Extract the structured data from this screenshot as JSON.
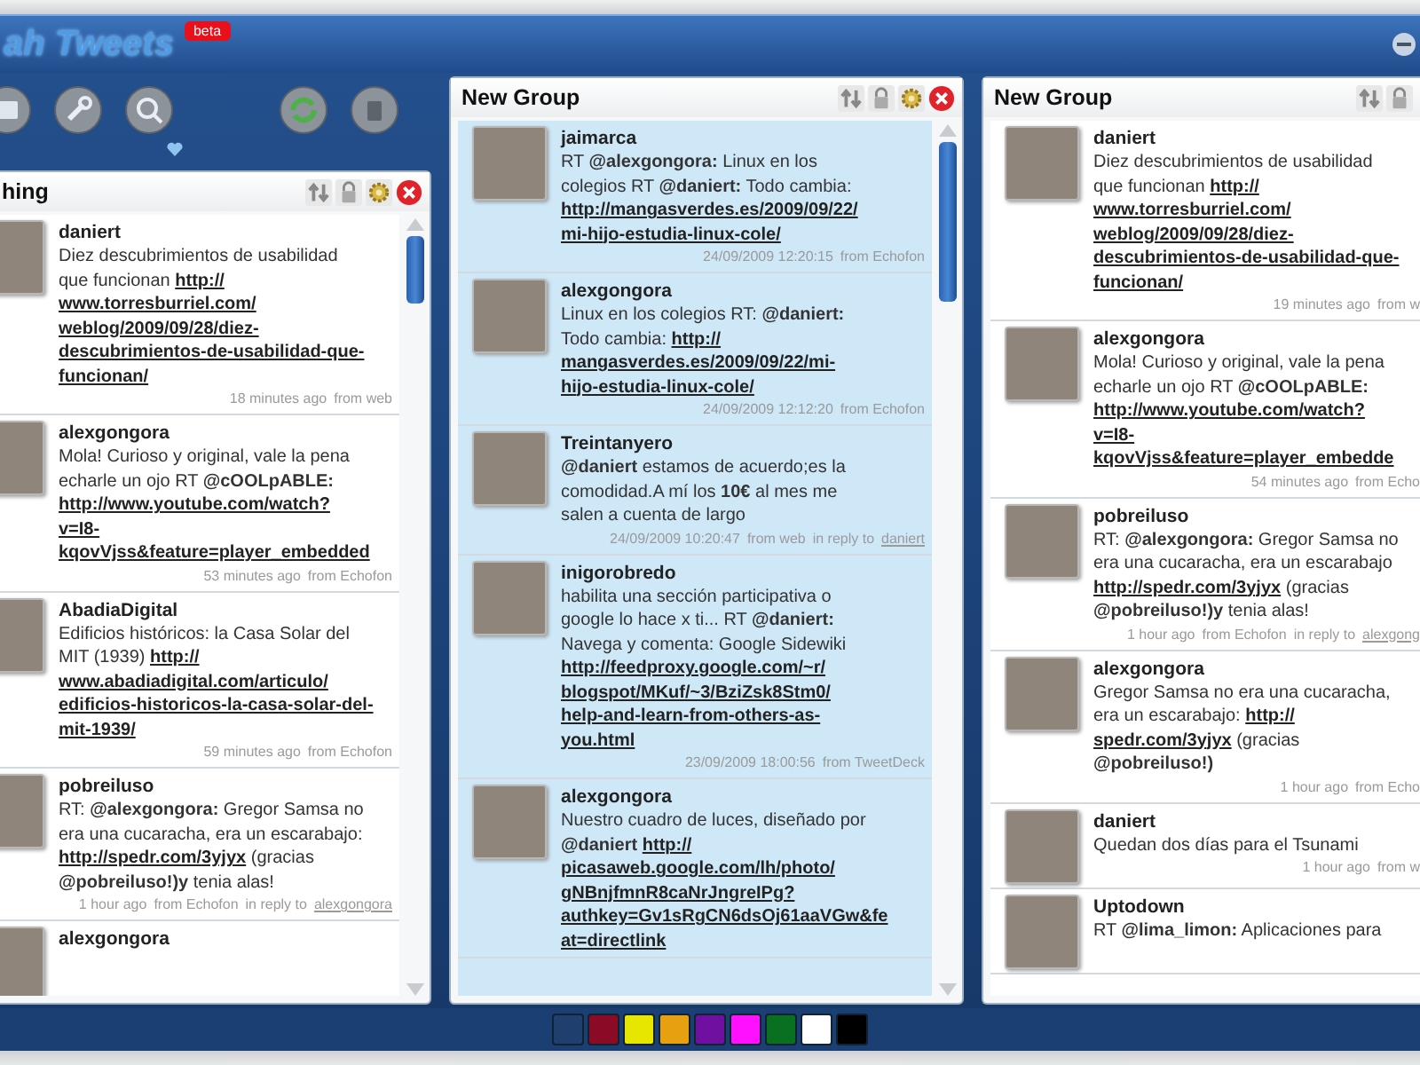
{
  "window": {
    "logo": "ah Tweets",
    "badge": "beta"
  },
  "columns": [
    {
      "title": "hing",
      "color": "#ffffff",
      "tweets": [
        {
          "user": "daniert",
          "lines": [
            {
              "text": "Diez descubrimientos de usabilidad"
            },
            {
              "text": "que funcionan ",
              "link": "http://"
            },
            {
              "link": "www.torresburriel.com/"
            },
            {
              "link": "weblog/2009/09/28/diez-"
            },
            {
              "link": "descubrimientos-de-usabilidad-que-"
            },
            {
              "link": "funcionan/"
            }
          ],
          "meta": {
            "time": "18 minutes ago",
            "source": "from web"
          }
        },
        {
          "user": "alexgongora",
          "lines": [
            {
              "text": "Mola! Curioso y original, vale la pena"
            },
            {
              "text": "echarle un ojo RT **@cOOLpABLE:**"
            },
            {
              "link": "http://www.youtube.com/watch?"
            },
            {
              "link": "v=I8-"
            },
            {
              "link": "kqovVjss&feature=player_embedded"
            }
          ],
          "meta": {
            "time": "53 minutes ago",
            "source": "from Echofon"
          }
        },
        {
          "user": "AbadiaDigital",
          "lines": [
            {
              "text": "Edificios históricos: la Casa Solar del"
            },
            {
              "text": "MIT (1939) ",
              "link": "http://"
            },
            {
              "link": "www.abadiadigital.com/articulo/"
            },
            {
              "link": "edificios-historicos-la-casa-solar-del-"
            },
            {
              "link": "mit-1939/"
            }
          ],
          "meta": {
            "time": "59 minutes ago",
            "source": "from Echofon"
          }
        },
        {
          "user": "pobreiluso",
          "lines": [
            {
              "text": "RT: **@alexgongora:** Gregor Samsa no"
            },
            {
              "text": "era una cucaracha, era un escarabajo:"
            },
            {
              "link": "http://spedr.com/3yjyx",
              "after": " (gracias"
            },
            {
              "text": "**@pobreiluso!)y** tenia alas!"
            }
          ],
          "meta": {
            "time": "1 hour ago",
            "source": "from Echofon",
            "reply_label": "in reply to",
            "reply_to": "alexgongora"
          }
        },
        {
          "user": "alexgongora"
        }
      ]
    },
    {
      "title": "New Group",
      "color": "#cfe8f8",
      "tweets": [
        {
          "user": "jaimarca",
          "lines": [
            {
              "text": "RT **@alexgongora:** Linux en los"
            },
            {
              "text": "colegios RT **@daniert:** Todo cambia:"
            },
            {
              "link": "http://mangasverdes.es/2009/09/22/"
            },
            {
              "link": "mi-hijo-estudia-linux-cole/"
            }
          ],
          "meta": {
            "time": "24/09/2009 12:20:15",
            "source": "from Echofon"
          }
        },
        {
          "user": "alexgongora",
          "lines": [
            {
              "text": "Linux en los colegios RT: **@daniert:**"
            },
            {
              "text": "Todo cambia: ",
              "link": "http://"
            },
            {
              "link": "mangasverdes.es/2009/09/22/mi-"
            },
            {
              "link": "hijo-estudia-linux-cole/"
            }
          ],
          "meta": {
            "time": "24/09/2009 12:12:20",
            "source": "from Echofon"
          }
        },
        {
          "user": "Treintanyero",
          "lines": [
            {
              "text": "**@daniert** estamos de acuerdo;es la"
            },
            {
              "text": "comodidad.A mí los **10€** al mes me"
            },
            {
              "text": "salen a cuenta de largo"
            }
          ],
          "meta": {
            "time": "24/09/2009 10:20:47",
            "source": "from web",
            "reply_label": "in reply to",
            "reply_to": "daniert"
          }
        },
        {
          "user": "inigorobredo",
          "lines": [
            {
              "text": "habilita una sección participativa o"
            },
            {
              "text": "google lo hace x ti... RT **@daniert:**"
            },
            {
              "text": "Navega y comenta: Google Sidewiki"
            },
            {
              "link": "http://feedproxy.google.com/~r/"
            },
            {
              "link": "blogspot/MKuf/~3/BziZsk8Stm0/"
            },
            {
              "link": "help-and-learn-from-others-as-"
            },
            {
              "link": "you.html"
            }
          ],
          "meta": {
            "time": "23/09/2009 18:00:56",
            "source": "from TweetDeck"
          }
        },
        {
          "user": "alexgongora",
          "lines": [
            {
              "text": "Nuestro cuadro de luces, diseñado por"
            },
            {
              "text": "**@daniert** ",
              "link": "http://"
            },
            {
              "link": "picasaweb.google.com/lh/photo/"
            },
            {
              "link": "gNBnjfmnR8caNrJngreIPg?"
            },
            {
              "link": "authkey=Gv1sRgCN6dsOj61aaVGw&fe"
            },
            {
              "link": "at=directlink"
            }
          ]
        }
      ]
    },
    {
      "title": "New Group",
      "color": "#ffffff",
      "tweets": [
        {
          "user": "daniert",
          "lines": [
            {
              "text": "Diez descubrimientos de usabilidad"
            },
            {
              "text": "que funcionan ",
              "link": "http://"
            },
            {
              "link": "www.torresburriel.com/"
            },
            {
              "link": "weblog/2009/09/28/diez-"
            },
            {
              "link": "descubrimientos-de-usabilidad-que-"
            },
            {
              "link": "funcionan/"
            }
          ],
          "meta": {
            "time": "19 minutes ago",
            "source": "from w"
          }
        },
        {
          "user": "alexgongora",
          "lines": [
            {
              "text": "Mola! Curioso y original, vale la pena"
            },
            {
              "text": "echarle un ojo RT **@cOOLpABLE:**"
            },
            {
              "link": "http://www.youtube.com/watch?"
            },
            {
              "link": "v=I8-"
            },
            {
              "link": "kqovVjss&feature=player_embedde"
            }
          ],
          "meta": {
            "time": "54 minutes ago",
            "source": "from Echo"
          }
        },
        {
          "user": "pobreiluso",
          "lines": [
            {
              "text": "RT: **@alexgongora:** Gregor Samsa no"
            },
            {
              "text": "era una cucaracha, era un escarabajo"
            },
            {
              "link": "http://spedr.com/3yjyx",
              "after": " (gracias"
            },
            {
              "text": "**@pobreiluso!)y** tenia alas!"
            }
          ],
          "meta": {
            "time": "1 hour ago",
            "source": "from Echofon",
            "reply_label": "in reply to",
            "reply_to": "alexgong"
          }
        },
        {
          "user": "alexgongora",
          "lines": [
            {
              "text": "Gregor Samsa no era una cucaracha,"
            },
            {
              "text": "era un escarabajo: ",
              "link": "http://"
            },
            {
              "link": "spedr.com/3yjyx",
              "after": " (gracias"
            },
            {
              "text": "**@pobreiluso!)**"
            }
          ],
          "meta": {
            "time": "1 hour ago",
            "source": "from Echo"
          }
        },
        {
          "user": "daniert",
          "lines": [
            {
              "text": "Quedan dos días para el Tsunami"
            }
          ],
          "meta": {
            "time": "1 hour ago",
            "source": "from w"
          }
        },
        {
          "user": "Uptodown",
          "lines": [
            {
              "text": "RT **@lima_limon:** Aplicaciones para"
            }
          ]
        }
      ]
    }
  ],
  "swatches": [
    {
      "color": "#1f3f6f"
    },
    {
      "color": "#8b0a25"
    },
    {
      "color": "#e6e600"
    },
    {
      "color": "#e6a010"
    },
    {
      "color": "#7010a0"
    },
    {
      "color": "#ff10ff"
    },
    {
      "color": "#087020"
    },
    {
      "color": "#ffffff"
    },
    {
      "color": "#000000"
    }
  ]
}
